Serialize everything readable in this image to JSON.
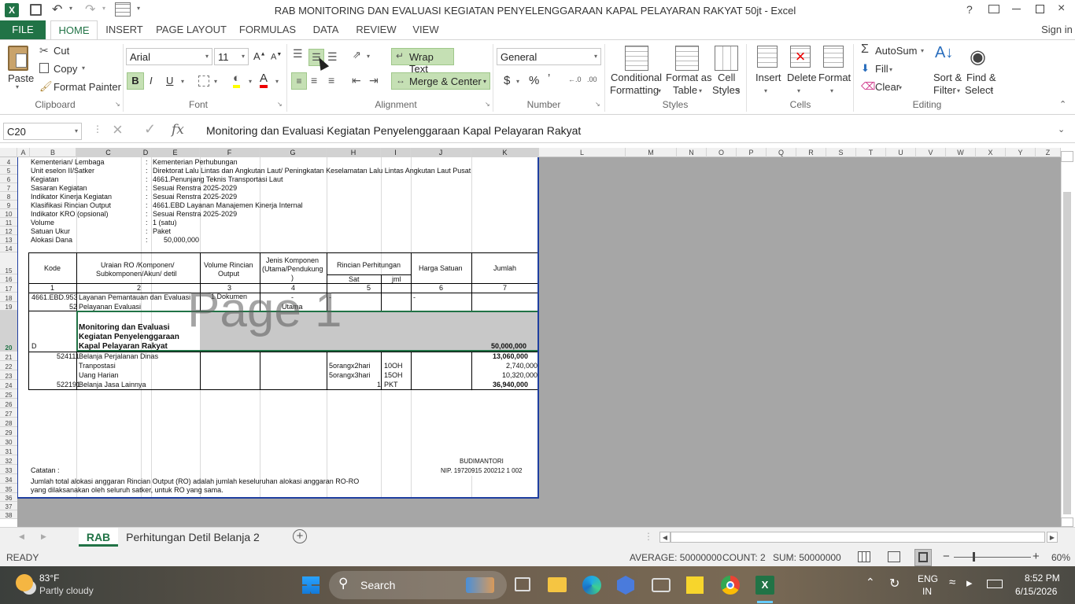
{
  "titlebar": {
    "title": "RAB MONITORING DAN EVALUASI KEGIATAN PENYELENGGARAAN KAPAL PELAYARAN RAKYAT 50jt - Excel",
    "help": "?"
  },
  "ribbon_tabs": [
    "FILE",
    "HOME",
    "INSERT",
    "PAGE LAYOUT",
    "FORMULAS",
    "DATA",
    "REVIEW",
    "VIEW"
  ],
  "signin": "Sign in",
  "clipboard": {
    "paste": "Paste",
    "cut": "Cut",
    "copy": "Copy",
    "format_painter": "Format Painter",
    "group": "Clipboard"
  },
  "font": {
    "name": "Arial",
    "size": "11",
    "group": "Font",
    "bold": "B",
    "italic": "I",
    "underline": "U"
  },
  "alignment": {
    "wrap": "Wrap Text",
    "merge": "Merge & Center",
    "group": "Alignment"
  },
  "number": {
    "format": "General",
    "currency": "$",
    "percent": "%",
    "comma": "ʼ",
    "group": "Number"
  },
  "styles": {
    "cond": "Conditional",
    "cond2": "Formatting",
    "fmt_table": "Format as",
    "fmt_table2": "Table",
    "cell_styles": "Cell",
    "cell_styles2": "Styles",
    "group": "Styles"
  },
  "cells": {
    "insert": "Insert",
    "delete": "Delete",
    "format": "Format",
    "group": "Cells"
  },
  "editing": {
    "autosum": "AutoSum",
    "fill": "Fill",
    "clear": "Clear",
    "sort": "Sort &",
    "sort2": "Filter",
    "find": "Find &",
    "find2": "Select",
    "group": "Editing"
  },
  "formula_bar": {
    "name_box": "C20",
    "fx": "fx",
    "content": "Monitoring dan Evaluasi Kegiatan Penyelenggaraan Kapal Pelayaran Rakyat"
  },
  "columns": [
    "A",
    "B",
    "C",
    "D",
    "E",
    "F",
    "G",
    "H",
    "I",
    "J",
    "K",
    "L",
    "M",
    "N",
    "O",
    "P",
    "Q",
    "R",
    "S",
    "T",
    "U",
    "V",
    "W",
    "X",
    "Y",
    "Z"
  ],
  "rows": [
    "4",
    "5",
    "6",
    "7",
    "8",
    "9",
    "10",
    "11",
    "12",
    "13",
    "14",
    "15",
    "16",
    "17",
    "18",
    "19",
    "20",
    "21",
    "22",
    "23",
    "24",
    "25",
    "26",
    "27",
    "28",
    "29",
    "30",
    "31",
    "32",
    "33",
    "34",
    "35",
    "36",
    "37",
    "38"
  ],
  "info": [
    {
      "label": "Kementerian/ Lembaga",
      "value": "Kementerian Perhubungan"
    },
    {
      "label": "Unit eselon II/Satker",
      "value": "Direktorat Lalu Lintas dan Angkutan Laut/ Peningkatan Keselamatan Lalu Lintas Angkutan Laut Pusat"
    },
    {
      "label": "Kegiatan",
      "value": "4661.Penunjang Teknis Transportasi Laut"
    },
    {
      "label": "Sasaran Kegiatan",
      "value": "Sesuai Renstra 2025-2029"
    },
    {
      "label": "Indikator Kinerja Kegiatan",
      "value": "Sesuai Renstra 2025-2029"
    },
    {
      "label": "Klasifikasi Rincian Output",
      "value": "4661.EBD Layanan Manajemen Kinerja Internal"
    },
    {
      "label": "Indikator KRO (opsional)",
      "value": "Sesuai Renstra 2025-2029"
    },
    {
      "label": "Volume",
      "value": "1 (satu)"
    },
    {
      "label": "Satuan Ukur",
      "value": "Paket"
    },
    {
      "label": "Alokasi Dana",
      "value": "50,000,000"
    }
  ],
  "colon": ":",
  "headers": {
    "kode": "Kode",
    "uraian1": "Uraian RO /Komponen/",
    "uraian2": "Subkomponen/Akun/ detil",
    "volume1": "Volume Rincian",
    "volume2": "Output",
    "jenis1": "Jenis Komponen",
    "jenis2": "(Utama/Pendukung",
    "jenis3": ")",
    "rincian": "Rincian Perhitungan",
    "sat": "Sat",
    "jml": "jml",
    "harga": "Harga Satuan",
    "jumlah": "Jumlah",
    "n1": "1",
    "n2": "2",
    "n3": "3",
    "n4": "4",
    "n5": "5",
    "n6": "6",
    "n7": "7"
  },
  "r18": {
    "kode": "4661.EBD.953",
    "uraian": "Layanan Pemantauan dan Evaluasi",
    "volume": "1 Dokumen",
    "jenis": "-",
    "sat": "-",
    "harga": "-"
  },
  "r19": {
    "kode": "52",
    "uraian": "Pelayanan Evaluasi",
    "jenis": "Utama"
  },
  "r20": {
    "kode": "D",
    "uraian1": "Monitoring dan Evaluasi",
    "uraian2": "Kegiatan Penyelenggaraan",
    "uraian3": "Kapal Pelayaran Rakyat",
    "jumlah": "50,000,000"
  },
  "r21": {
    "kode": "524111",
    "uraian": "Belanja Perjalanan Dinas",
    "jumlah": "13,060,000"
  },
  "r22": {
    "uraian": "Tranpostasi",
    "sat": "5orangx2hari",
    "jml": "10OH",
    "jumlah": "2,740,000"
  },
  "r23": {
    "uraian": "Uang Harian",
    "sat": "5orangx3hari",
    "jml": "15OH",
    "jumlah": "10,320,000"
  },
  "r24": {
    "kode": "522191",
    "uraian": "Belanja Jasa Lainnya",
    "sat": "1",
    "jml": "PKT",
    "jumlah": "36,940,000"
  },
  "page_watermark": "Page 1",
  "signatory": {
    "name": "BUDIMANTORI",
    "nip": "NIP. 19720915 200212 1 002"
  },
  "catatan": "Catatan :",
  "note1": "Jumlah total alokasi anggaran Rincian Output (RO) adalah jumlah keseluruhan alokasi anggaran RO-RO",
  "note2": "yang dilaksanakan oleh seluruh satker, untuk RO yang sama.",
  "sheets": [
    "RAB",
    "Perhitungan Detil Belanja 2"
  ],
  "status": {
    "ready": "READY",
    "average": "AVERAGE: 50000000",
    "count": "COUNT: 2",
    "sum": "SUM: 50000000",
    "zoom": "60%"
  },
  "taskbar": {
    "temp": "83°F",
    "weather": "Partly cloudy",
    "search": "Search",
    "lang1": "ENG",
    "lang2": "IN",
    "time": "8:52 PM",
    "date": "6/15/2026"
  },
  "colors": {
    "excel_green": "#217346",
    "selection_border": "#217346",
    "print_border": "#1f3fa0"
  }
}
